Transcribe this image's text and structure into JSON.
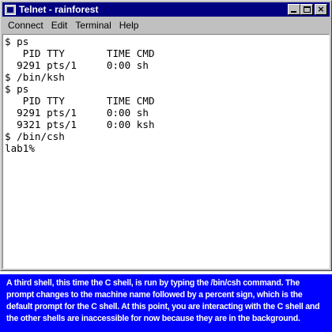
{
  "window": {
    "title": "Telnet - rainforest",
    "icons": {
      "app": "telnet-app-icon",
      "minimize": "minimize-icon",
      "maximize": "maximize-icon",
      "close": "close-icon"
    },
    "close_glyph": "×"
  },
  "menu": {
    "items": [
      {
        "label": "Connect"
      },
      {
        "label": "Edit"
      },
      {
        "label": "Terminal"
      },
      {
        "label": "Help"
      }
    ]
  },
  "terminal": {
    "lines": [
      "$ ps",
      "   PID TTY       TIME CMD",
      "  9291 pts/1     0:00 sh",
      "$ /bin/ksh",
      "$ ps",
      "   PID TTY       TIME CMD",
      "  9291 pts/1     0:00 sh",
      "  9321 pts/1     0:00 ksh",
      "$ /bin/csh",
      "lab1%"
    ]
  },
  "caption": {
    "text": "A third shell, this time the C shell, is run by typing the /bin/csh command.  The prompt changes to the machine name followed by a percent sign, which is the default prompt for the C shell. At this point, you are interacting with the C shell and the other shells are inaccessible for now because they are in the background."
  },
  "colors": {
    "titlebar": "#000080",
    "window_face": "#c0c0c0",
    "terminal_bg": "#ffffff",
    "caption_bg": "#0000ff",
    "caption_text": "#ffffff"
  }
}
